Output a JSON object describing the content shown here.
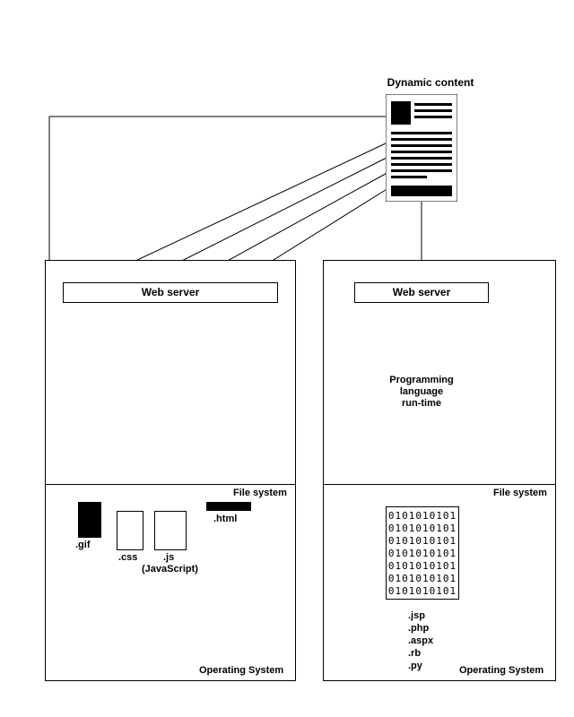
{
  "title": "Dynamic content",
  "left": {
    "web_server": "Web server",
    "file_system": "File system",
    "operating_system": "Operating System",
    "files": {
      "gif": ".gif",
      "css": ".css",
      "js": ".js",
      "js_sub": "(JavaScript)",
      "html": ".html"
    }
  },
  "right": {
    "web_server": "Web server",
    "runtime": "Programming\nlanguage\nrun-time",
    "file_system": "File system",
    "operating_system": "Operating System",
    "binary": "0101010101\n0101010101\n0101010101\n0101010101\n0101010101\n0101010101\n0101010101",
    "exts": ".jsp\n.php\n.aspx\n.rb\n.py"
  }
}
